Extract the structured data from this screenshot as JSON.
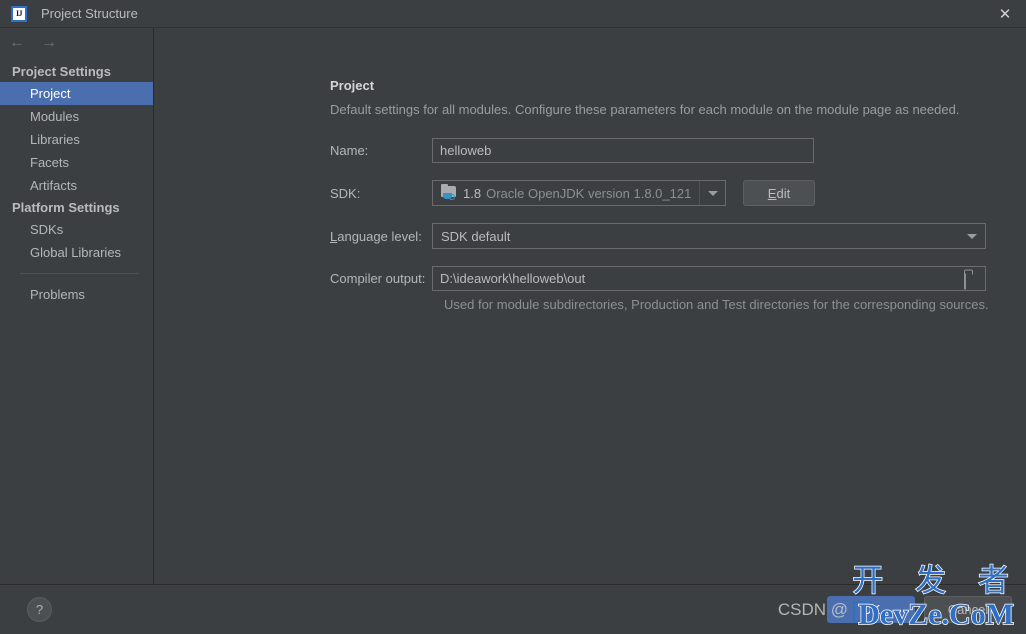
{
  "window": {
    "title": "Project Structure",
    "logo_icon": "intellij-idea-logo",
    "close_icon": "close-icon",
    "back_icon": "arrow-left-icon",
    "forward_icon": "arrow-right-icon",
    "back_glyph": "←",
    "forward_glyph": "→",
    "close_glyph": "✕",
    "logo_text": "IJ"
  },
  "sidebar": {
    "sections": [
      {
        "header": "Project Settings",
        "items": [
          {
            "label": "Project",
            "selected": true
          },
          {
            "label": "Modules",
            "selected": false
          },
          {
            "label": "Libraries",
            "selected": false
          },
          {
            "label": "Facets",
            "selected": false
          },
          {
            "label": "Artifacts",
            "selected": false
          }
        ]
      },
      {
        "header": "Platform Settings",
        "items": [
          {
            "label": "SDKs",
            "selected": false
          },
          {
            "label": "Global Libraries",
            "selected": false
          }
        ]
      }
    ],
    "problems_label": "Problems"
  },
  "main": {
    "panel_title": "Project",
    "panel_description": "Default settings for all modules. Configure these parameters for each module on the module page as needed.",
    "name": {
      "label": "Name:",
      "value": "helloweb"
    },
    "sdk": {
      "label": "SDK:",
      "icon": "jdk-icon",
      "version": "1.8",
      "description": "Oracle OpenJDK version 1.8.0_121",
      "edit_button_mnemonic": "E",
      "edit_button_rest": "dit"
    },
    "language_level": {
      "label_mnemonic": "L",
      "label_rest": "anguage level:",
      "value": "SDK default"
    },
    "compiler_output": {
      "label": "Compiler output:",
      "value": "D:\\ideawork\\helloweb\\out",
      "browse_icon": "folder-browse-icon",
      "hint": "Used for module subdirectories, Production and Test directories for the corresponding sources."
    }
  },
  "footer": {
    "help_label": "?",
    "ok_label": "OK",
    "cancel_label": "Cancel"
  },
  "watermark": {
    "chinese": "开 发 者",
    "english": "DevZe.CoM",
    "csdn": "CSDN @"
  },
  "colors": {
    "background": "#3c3f41",
    "selection": "#4b6eaf",
    "accent_blue": "#3592c4",
    "text": "#bbbbbb",
    "text_dim": "#8d9093",
    "watermark_blue": "#2f6fc4"
  }
}
